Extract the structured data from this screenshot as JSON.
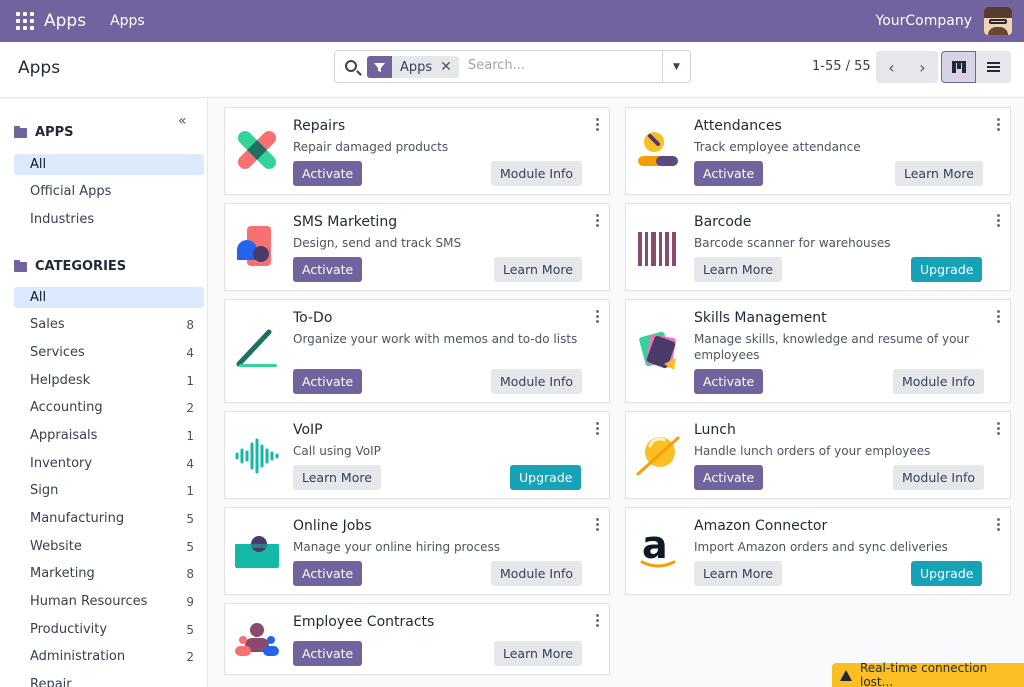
{
  "navbar": {
    "app_title": "Apps",
    "menu_item": "Apps",
    "company": "YourCompany",
    "menu_icon": "grid-icon",
    "brand_color": "#71639e"
  },
  "control_panel": {
    "title": "Apps",
    "facet_label": "Apps",
    "search_placeholder": "Search...",
    "pager": "1-55 / 55",
    "active_view": "kanban"
  },
  "sidebar": {
    "apps_heading": "APPS",
    "apps_items": [
      "All",
      "Official Apps",
      "Industries"
    ],
    "categories_heading": "CATEGORIES",
    "categories": [
      {
        "label": "All",
        "count": ""
      },
      {
        "label": "Sales",
        "count": "8"
      },
      {
        "label": "Services",
        "count": "4"
      },
      {
        "label": "Helpdesk",
        "count": "1"
      },
      {
        "label": "Accounting",
        "count": "2"
      },
      {
        "label": "Appraisals",
        "count": "1"
      },
      {
        "label": "Inventory",
        "count": "4"
      },
      {
        "label": "Sign",
        "count": "1"
      },
      {
        "label": "Manufacturing",
        "count": "5"
      },
      {
        "label": "Website",
        "count": "5"
      },
      {
        "label": "Marketing",
        "count": "8"
      },
      {
        "label": "Human Resources",
        "count": "9"
      },
      {
        "label": "Productivity",
        "count": "5"
      },
      {
        "label": "Administration",
        "count": "2"
      },
      {
        "label": "Repair",
        "count": ""
      }
    ]
  },
  "apps": [
    {
      "name": "Repairs",
      "summary": "Repair damaged products",
      "primary": "Activate",
      "secondary": "Module Info"
    },
    {
      "name": "Attendances",
      "summary": "Track employee attendance",
      "primary": "Activate",
      "secondary": "Learn More"
    },
    {
      "name": "SMS Marketing",
      "summary": "Design, send and track SMS",
      "primary": "Activate",
      "secondary": "Learn More"
    },
    {
      "name": "Barcode",
      "summary": "Barcode scanner for warehouses",
      "primary": "Learn More",
      "secondary": "Upgrade"
    },
    {
      "name": "To-Do",
      "summary": "Organize your work with memos and to-do lists",
      "primary": "Activate",
      "secondary": "Module Info"
    },
    {
      "name": "Skills Management",
      "summary": "Manage skills, knowledge and resume of your employees",
      "primary": "Activate",
      "secondary": "Module Info"
    },
    {
      "name": "VoIP",
      "summary": "Call using VoIP",
      "primary": "Learn More",
      "secondary": "Upgrade"
    },
    {
      "name": "Lunch",
      "summary": "Handle lunch orders of your employees",
      "primary": "Activate",
      "secondary": "Module Info"
    },
    {
      "name": "Online Jobs",
      "summary": "Manage your online hiring process",
      "primary": "Activate",
      "secondary": "Module Info"
    },
    {
      "name": "Amazon Connector",
      "summary": "Import Amazon orders and sync deliveries",
      "primary": "Learn More",
      "secondary": "Upgrade"
    },
    {
      "name": "Employee Contracts",
      "summary": "",
      "primary": "Activate",
      "secondary": "Learn More"
    }
  ],
  "amazon_logo_letter": "a",
  "toast": "Real-time connection lost..."
}
